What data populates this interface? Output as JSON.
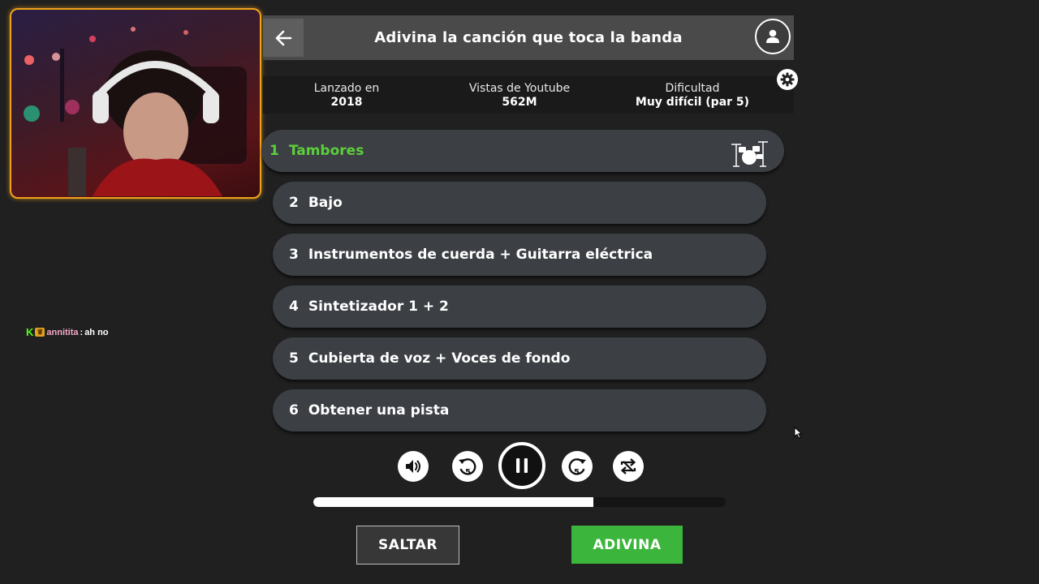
{
  "webcam": {
    "frame_color": "#f0a21a"
  },
  "chat": {
    "badge_k": "K",
    "username": "annitita",
    "separator": ":",
    "message": "ah no"
  },
  "header": {
    "title": "Adivina la canción que toca la banda",
    "back_icon": "arrow-left-icon",
    "profile_icon": "user-icon"
  },
  "info": [
    {
      "label": "Lanzado en",
      "value": "2018"
    },
    {
      "label": "Vistas de Youtube",
      "value": "562M"
    },
    {
      "label": "Dificultad",
      "value": "Muy difícil (par 5)"
    }
  ],
  "tracks": [
    {
      "num": "1",
      "label": "Tambores",
      "active": true,
      "icon": "drum-kit-icon"
    },
    {
      "num": "2",
      "label": "Bajo"
    },
    {
      "num": "3",
      "label": "Instrumentos de cuerda + Guitarra eléctrica"
    },
    {
      "num": "4",
      "label": "Sintetizador 1 + 2"
    },
    {
      "num": "5",
      "label": "Cubierta de voz + Voces de fondo"
    },
    {
      "num": "6",
      "label": "Obtener una pista"
    }
  ],
  "controls": {
    "rewind_seconds": "5",
    "forward_seconds": "5",
    "progress": 0.68
  },
  "buttons": {
    "skip": "SALTAR",
    "guess": "ADIVINA"
  },
  "colors": {
    "active_track": "#5ccf3c",
    "guess_button": "#3bb53b",
    "background": "#202020"
  }
}
